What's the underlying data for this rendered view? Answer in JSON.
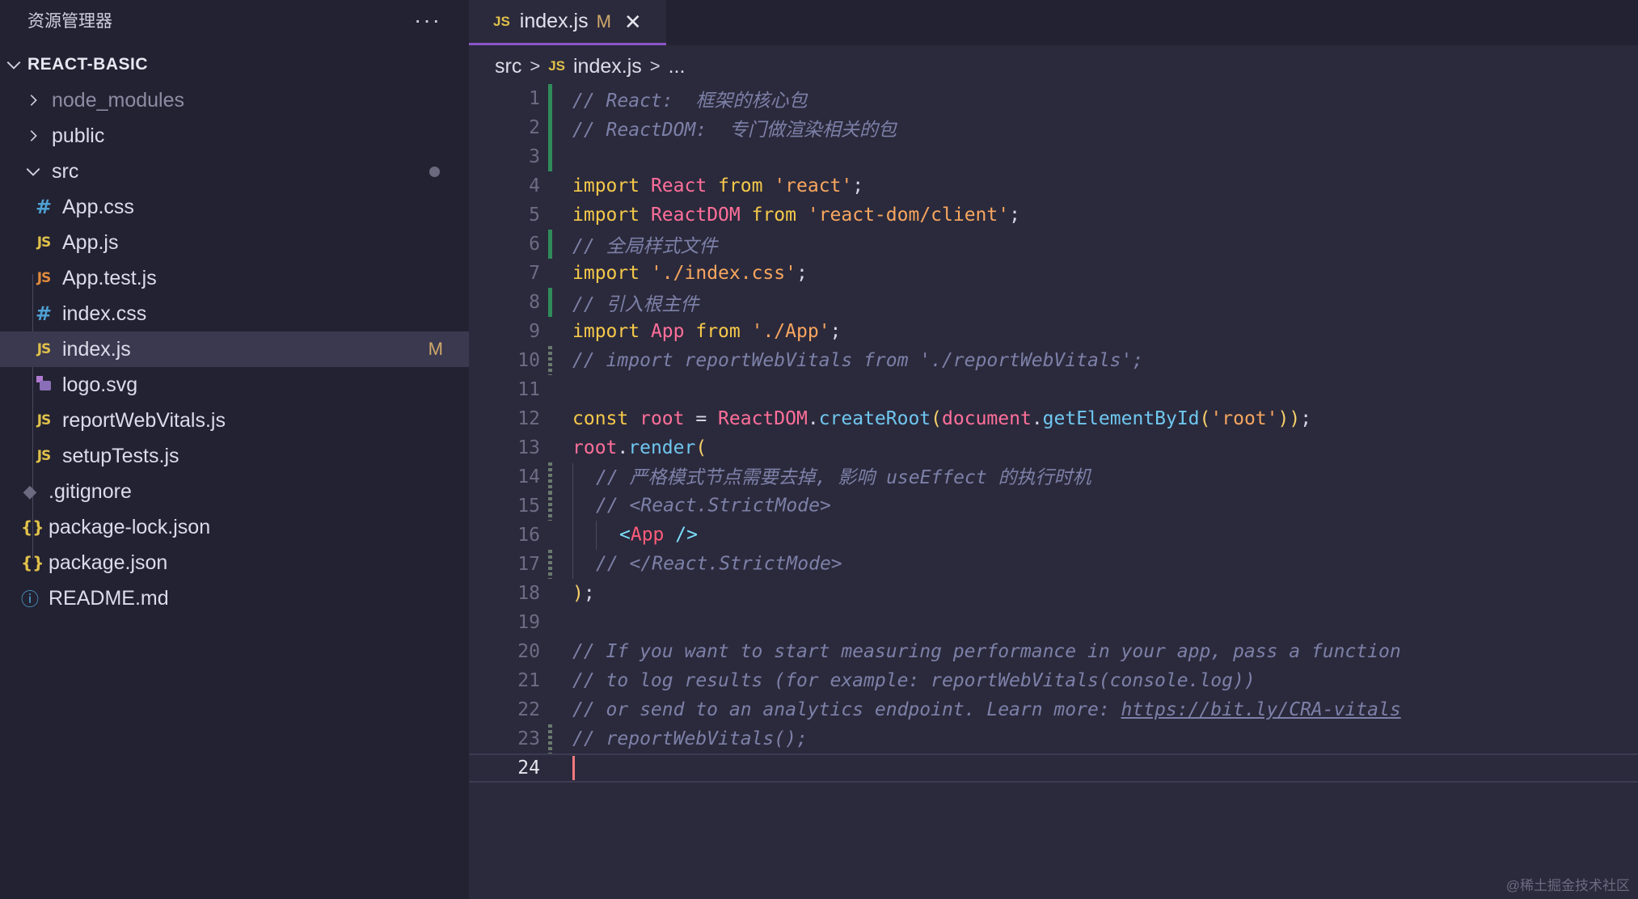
{
  "sidebar": {
    "title": "资源管理器",
    "more_label": "···",
    "project_name": "REACT-BASIC",
    "items": [
      {
        "label": "node_modules"
      },
      {
        "label": "public"
      },
      {
        "label": "src"
      },
      {
        "label": "App.css",
        "icon_text": "#"
      },
      {
        "label": "App.js",
        "icon_text": "JS"
      },
      {
        "label": "App.test.js",
        "icon_text": "JS"
      },
      {
        "label": "index.css",
        "icon_text": "#"
      },
      {
        "label": "index.js",
        "icon_text": "JS",
        "status": "M"
      },
      {
        "label": "logo.svg"
      },
      {
        "label": "reportWebVitals.js",
        "icon_text": "JS"
      },
      {
        "label": "setupTests.js",
        "icon_text": "JS"
      },
      {
        "label": ".gitignore"
      },
      {
        "label": "package-lock.json",
        "icon_text": "{}"
      },
      {
        "label": "package.json",
        "icon_text": "{}"
      },
      {
        "label": "README.md",
        "icon_text": "ⓘ"
      }
    ]
  },
  "tab": {
    "icon_text": "JS",
    "label": "index.js",
    "status": "M",
    "close_label": "✕"
  },
  "breadcrumb": {
    "folder": "src",
    "icon_text": "JS",
    "file": "index.js",
    "more": "..."
  },
  "code": {
    "line_numbers": [
      "1",
      "2",
      "3",
      "4",
      "5",
      "6",
      "7",
      "8",
      "9",
      "10",
      "11",
      "12",
      "13",
      "14",
      "15",
      "16",
      "17",
      "18",
      "19",
      "20",
      "21",
      "22",
      "23",
      "24"
    ],
    "lines": [
      [
        "// React:  框架的核心包"
      ],
      [
        "// ReactDOM:  专门做渲染相关的包"
      ],
      [],
      [
        "import",
        " ",
        "React",
        " ",
        "from",
        " ",
        "'react'",
        ";"
      ],
      [
        "import",
        " ",
        "ReactDOM",
        " ",
        "from",
        " ",
        "'react-dom/client'",
        ";"
      ],
      [
        "// 全局样式文件"
      ],
      [
        "import",
        " ",
        "'./index.css'",
        ";"
      ],
      [
        "// 引入根主件"
      ],
      [
        "import",
        " ",
        "App",
        " ",
        "from",
        " ",
        "'./App'",
        ";"
      ],
      [
        "// import reportWebVitals from './reportWebVitals';"
      ],
      [],
      [
        "const",
        " ",
        "root",
        " = ",
        "ReactDOM",
        ".",
        "createRoot",
        "(",
        "document",
        ".",
        "getElementById",
        "(",
        "'root'",
        ")",
        ")",
        ";"
      ],
      [
        "root",
        ".",
        "render",
        "("
      ],
      [
        "// 严格模式节点需要去掉, 影响 useEffect 的执行时机"
      ],
      [
        "// <React.StrictMode>"
      ],
      [
        "<",
        "App",
        " />"
      ],
      [
        "// </React.StrictMode>"
      ],
      [
        ")",
        ";"
      ],
      [],
      [
        "// If you want to start measuring performance in your app, pass a function"
      ],
      [
        "// to log results (for example: reportWebVitals(console.log))"
      ],
      [
        "// or send to an analytics endpoint. Learn more: ",
        "https://bit.ly/CRA-vitals"
      ],
      [
        "// reportWebVitals();"
      ],
      []
    ]
  },
  "watermark": "@稀土掘金技术社区",
  "colors": {
    "accent": "#8a56c8",
    "modified": "#cfa86b",
    "added": "#2f8c5a",
    "cursor": "#f4797f"
  }
}
